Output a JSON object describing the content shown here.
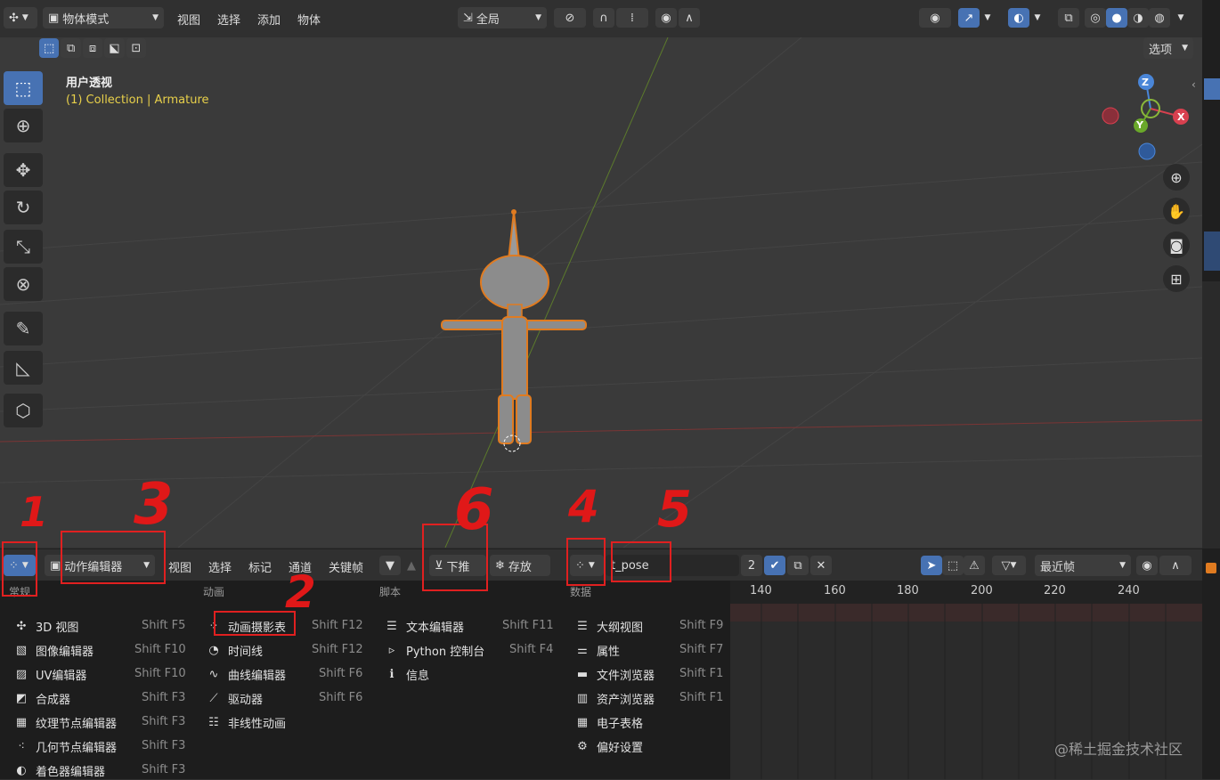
{
  "top_header": {
    "mode_label": "物体模式",
    "menus": [
      "视图",
      "选择",
      "添加",
      "物体"
    ],
    "transform_orientation": "全局",
    "options_label": "选项"
  },
  "viewport": {
    "view_name": "用户透视",
    "collection_line": "(1) Collection | Armature",
    "gizmo_axes": [
      "Z",
      "Y",
      "X"
    ]
  },
  "bottom_header": {
    "editor_name": "动作编辑器",
    "menus": [
      "视图",
      "选择",
      "标记",
      "通道",
      "关键帧"
    ],
    "push_down": "下推",
    "stash": "存放",
    "action_name": "t_pose",
    "users_count": "2",
    "playback_mode": "最近帧"
  },
  "editor_menu": {
    "columns": [
      {
        "header": "常规",
        "items": [
          {
            "label": "3D 视图",
            "shortcut": "Shift F5",
            "icon": "3d-view-icon"
          },
          {
            "label": "图像编辑器",
            "shortcut": "Shift F10",
            "icon": "image-editor-icon"
          },
          {
            "label": "UV编辑器",
            "shortcut": "Shift F10",
            "icon": "uv-editor-icon"
          },
          {
            "label": "合成器",
            "shortcut": "Shift F3",
            "icon": "compositor-icon"
          },
          {
            "label": "纹理节点编辑器",
            "shortcut": "Shift F3",
            "icon": "texture-node-icon"
          },
          {
            "label": "几何节点编辑器",
            "shortcut": "Shift F3",
            "icon": "geometry-node-icon"
          },
          {
            "label": "着色器编辑器",
            "shortcut": "Shift F3",
            "icon": "shader-editor-icon"
          }
        ]
      },
      {
        "header": "动画",
        "items": [
          {
            "label": "动画摄影表",
            "shortcut": "Shift F12",
            "icon": "dope-sheet-icon"
          },
          {
            "label": "时间线",
            "shortcut": "Shift F12",
            "icon": "timeline-icon"
          },
          {
            "label": "曲线编辑器",
            "shortcut": "Shift F6",
            "icon": "graph-editor-icon"
          },
          {
            "label": "驱动器",
            "shortcut": "Shift F6",
            "icon": "drivers-icon"
          },
          {
            "label": "非线性动画",
            "shortcut": "",
            "icon": "nla-icon"
          }
        ]
      },
      {
        "header": "脚本",
        "items": [
          {
            "label": "文本编辑器",
            "shortcut": "Shift F11",
            "icon": "text-editor-icon"
          },
          {
            "label": "Python 控制台",
            "shortcut": "Shift F4",
            "icon": "python-console-icon"
          },
          {
            "label": "信息",
            "shortcut": "",
            "icon": "info-icon"
          }
        ]
      },
      {
        "header": "数据",
        "items": [
          {
            "label": "大纲视图",
            "shortcut": "Shift F9",
            "icon": "outliner-icon"
          },
          {
            "label": "属性",
            "shortcut": "Shift F7",
            "icon": "properties-icon"
          },
          {
            "label": "文件浏览器",
            "shortcut": "Shift F1",
            "icon": "file-browser-icon"
          },
          {
            "label": "资产浏览器",
            "shortcut": "Shift F1",
            "icon": "asset-browser-icon"
          },
          {
            "label": "电子表格",
            "shortcut": "",
            "icon": "spreadsheet-icon"
          },
          {
            "label": "偏好设置",
            "shortcut": "",
            "icon": "preferences-icon"
          }
        ]
      }
    ]
  },
  "timeline": {
    "frames": [
      "140",
      "160",
      "180",
      "200",
      "220",
      "240"
    ]
  },
  "annotations": [
    "1",
    "2",
    "3",
    "4",
    "5",
    "6"
  ],
  "watermark": "@稀土掘金技术社区",
  "colors": {
    "accent": "#4772b3",
    "annotation": "#e02020",
    "collection_text": "#e8d04a"
  }
}
